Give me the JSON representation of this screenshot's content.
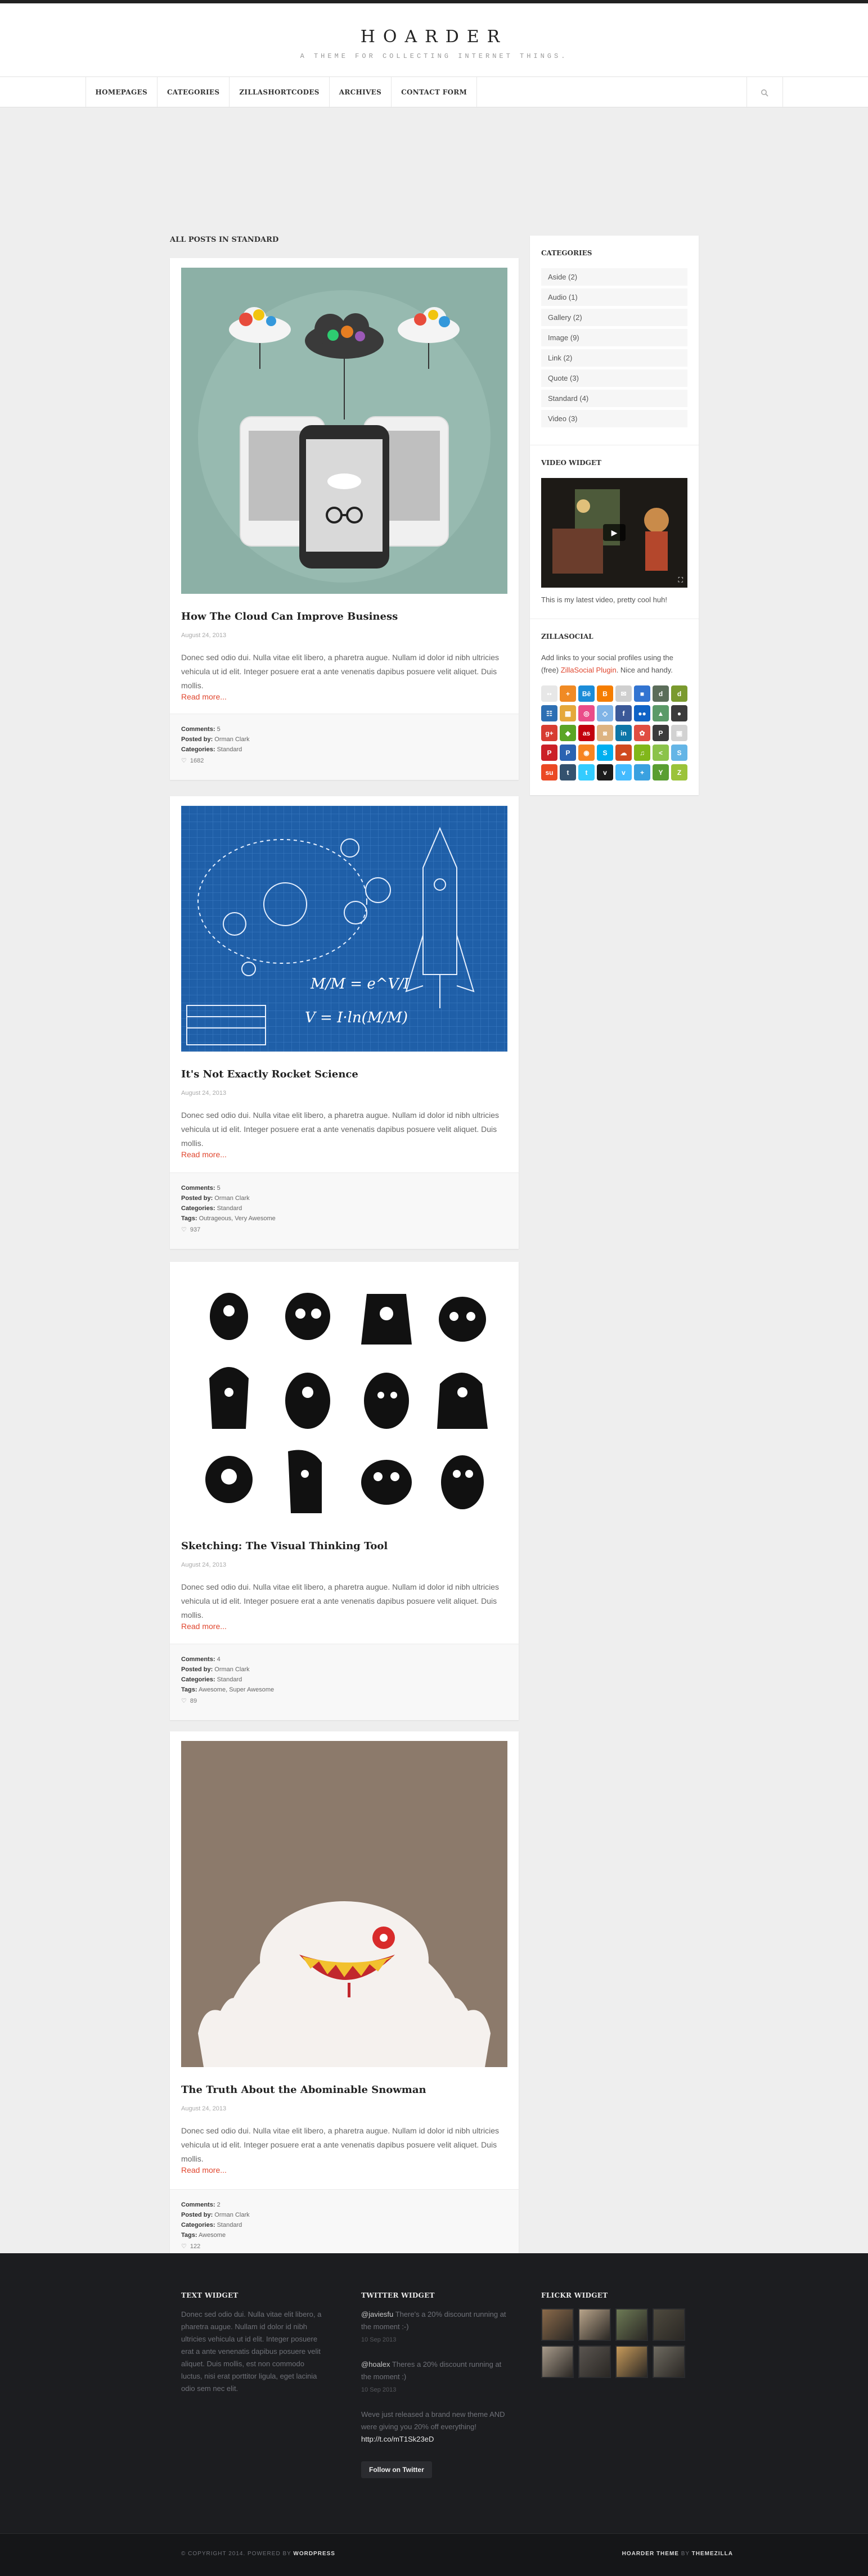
{
  "site": {
    "title": "HOARDER",
    "tagline": "A THEME FOR COLLECTING INTERNET THINGS."
  },
  "nav": {
    "items": [
      "HOMEPAGES",
      "CATEGORIES",
      "ZILLASHORTCODES",
      "ARCHIVES",
      "CONTACT FORM"
    ],
    "search_icon": "search-icon"
  },
  "archive_title": "ALL POSTS IN STANDARD",
  "posts": [
    {
      "title": "How The Cloud Can Improve Business",
      "date": "August 24, 2013",
      "excerpt": "Donec sed odio dui. Nulla vitae elit libero, a pharetra augue. Nullam id dolor id nibh ultricies vehicula ut id elit. Integer posuere erat a ante venenatis dapibus posuere velit aliquet. Duis mollis.",
      "read_more": "Read more...",
      "comments_label": "Comments:",
      "comments": "5",
      "posted_label": "Posted by:",
      "author": "Orman Clark",
      "categories_label": "Categories:",
      "categories": "Standard",
      "tags_label": "",
      "tags": "",
      "likes": "1682"
    },
    {
      "title": "It's Not Exactly Rocket Science",
      "date": "August 24, 2013",
      "excerpt": "Donec sed odio dui. Nulla vitae elit libero, a pharetra augue. Nullam id dolor id nibh ultricies vehicula ut id elit. Integer posuere erat a ante venenatis dapibus posuere velit aliquet. Duis mollis.",
      "read_more": "Read more...",
      "comments_label": "Comments:",
      "comments": "5",
      "posted_label": "Posted by:",
      "author": "Orman Clark",
      "categories_label": "Categories:",
      "categories": "Standard",
      "tags_label": "Tags:",
      "tags": "Outrageous, Very Awesome",
      "likes": "937"
    },
    {
      "title": "Sketching: The Visual Thinking Tool",
      "date": "August 24, 2013",
      "excerpt": "Donec sed odio dui. Nulla vitae elit libero, a pharetra augue. Nullam id dolor id nibh ultricies vehicula ut id elit. Integer posuere erat a ante venenatis dapibus posuere velit aliquet. Duis mollis.",
      "read_more": "Read more...",
      "comments_label": "Comments:",
      "comments": "4",
      "posted_label": "Posted by:",
      "author": "Orman Clark",
      "categories_label": "Categories:",
      "categories": "Standard",
      "tags_label": "Tags:",
      "tags": "Awesome, Super Awesome",
      "likes": "89"
    },
    {
      "title": "The Truth About the Abominable Snowman",
      "date": "August 24, 2013",
      "excerpt": "Donec sed odio dui. Nulla vitae elit libero, a pharetra augue. Nullam id dolor id nibh ultricies vehicula ut id elit. Integer posuere erat a ante venenatis dapibus posuere velit aliquet. Duis mollis.",
      "read_more": "Read more...",
      "comments_label": "Comments:",
      "comments": "2",
      "posted_label": "Posted by:",
      "author": "Orman Clark",
      "categories_label": "Categories:",
      "categories": "Standard",
      "tags_label": "Tags:",
      "tags": "Awesome",
      "likes": "122"
    }
  ],
  "sidebar": {
    "categories_title": "CATEGORIES",
    "categories": [
      "Aside (2)",
      "Audio (1)",
      "Gallery (2)",
      "Image (9)",
      "Link (2)",
      "Quote (3)",
      "Standard (4)",
      "Video (3)"
    ],
    "video_title": "VIDEO WIDGET",
    "video_caption": "This is my latest video, pretty cool huh!",
    "social_title": "ZILLASOCIAL",
    "social_text_1": "Add links to your social profiles using the (free)",
    "social_link": "ZillaSocial Plugin",
    "social_text_2": ". Nice and handy.",
    "social_icons": [
      {
        "name": "flickr-icon",
        "color": "#e7e7e7",
        "glyph": "••"
      },
      {
        "name": "add-icon",
        "color": "#f08a24",
        "glyph": "+"
      },
      {
        "name": "behance-icon",
        "color": "#1b8cd8",
        "glyph": "Bē"
      },
      {
        "name": "blogger-icon",
        "color": "#f57d00",
        "glyph": "B"
      },
      {
        "name": "email-icon",
        "color": "#cfcfcf",
        "glyph": "✉"
      },
      {
        "name": "delicious-icon",
        "color": "#3274d1",
        "glyph": "■"
      },
      {
        "name": "deviantart-icon",
        "color": "#5b6d5a",
        "glyph": "d"
      },
      {
        "name": "digg-icon",
        "color": "#7a9a2e",
        "glyph": "d"
      },
      {
        "name": "dribbble-like-icon",
        "color": "#2d6fb3",
        "glyph": "☷"
      },
      {
        "name": "forrst-icon",
        "color": "#e5a83b",
        "glyph": "▦"
      },
      {
        "name": "dribbble-icon",
        "color": "#ea4c89",
        "glyph": "◎"
      },
      {
        "name": "dropbox-icon",
        "color": "#7fb3e6",
        "glyph": "◇"
      },
      {
        "name": "facebook-icon",
        "color": "#3b5998",
        "glyph": "f"
      },
      {
        "name": "flickr-dots-icon",
        "color": "#0f63c6",
        "glyph": "●●"
      },
      {
        "name": "forrst-tree-icon",
        "color": "#5b9a68",
        "glyph": "▲"
      },
      {
        "name": "github-icon",
        "color": "#3b3b3b",
        "glyph": "●"
      },
      {
        "name": "google-plus-icon",
        "color": "#d73d32",
        "glyph": "g+"
      },
      {
        "name": "evernote-icon",
        "color": "#5ba525",
        "glyph": "◆"
      },
      {
        "name": "lastfm-icon",
        "color": "#c3000d",
        "glyph": "as"
      },
      {
        "name": "instagram-icon",
        "color": "#ddb381",
        "glyph": "◙"
      },
      {
        "name": "linkedin-icon",
        "color": "#0e76a8",
        "glyph": "in"
      },
      {
        "name": "picasa-icon",
        "color": "#e04e42",
        "glyph": "✿"
      },
      {
        "name": "path-icon",
        "color": "#3b3b3b",
        "glyph": "P"
      },
      {
        "name": "picasa-alt-icon",
        "color": "#d2d2d2",
        "glyph": "▣"
      },
      {
        "name": "pinterest-icon",
        "color": "#cb2027",
        "glyph": "P"
      },
      {
        "name": "paypal-icon",
        "color": "#2a63b2",
        "glyph": "P"
      },
      {
        "name": "rss-icon",
        "color": "#f78422",
        "glyph": "◉"
      },
      {
        "name": "skype-icon",
        "color": "#00aff0",
        "glyph": "S"
      },
      {
        "name": "rdio-icon",
        "color": "#d04a1f",
        "glyph": "☁"
      },
      {
        "name": "spotify-icon",
        "color": "#81b71a",
        "glyph": "♫"
      },
      {
        "name": "share-icon",
        "color": "#8bc34a",
        "glyph": "<"
      },
      {
        "name": "skype-alt-icon",
        "color": "#64b5e6",
        "glyph": "S"
      },
      {
        "name": "stumbleupon-icon",
        "color": "#eb4924",
        "glyph": "su"
      },
      {
        "name": "tumblr-icon",
        "color": "#34526f",
        "glyph": "t"
      },
      {
        "name": "twitter-icon",
        "color": "#33ccff",
        "glyph": "t"
      },
      {
        "name": "vimeo-icon",
        "color": "#1b1b1b",
        "glyph": "v"
      },
      {
        "name": "vimeo-blue-icon",
        "color": "#44bbff",
        "glyph": "v"
      },
      {
        "name": "plus-icon",
        "color": "#3aa1e0",
        "glyph": "+"
      },
      {
        "name": "yahoo-icon",
        "color": "#5a9e31",
        "glyph": "Y"
      },
      {
        "name": "zerply-icon",
        "color": "#9bc33a",
        "glyph": "Z"
      }
    ]
  },
  "footer": {
    "text_widget_title": "TEXT WIDGET",
    "text_widget_body": "Donec sed odio dui. Nulla vitae elit libero, a pharetra augue. Nullam id dolor id nibh ultricies vehicula ut id elit. Integer posuere erat a ante venenatis dapibus posuere velit aliquet. Duis mollis, est non commodo luctus, nisi erat porttitor ligula, eget lacinia odio sem nec elit.",
    "twitter_title": "TWITTER WIDGET",
    "tweets": [
      {
        "handle": "@javiesfu",
        "text": " There's a 20% discount running at the moment :-)",
        "time": "10 Sep 2013"
      },
      {
        "handle": "@hoalex",
        "text": " Theres a 20% discount running at the moment :)",
        "time": "10 Sep 2013"
      },
      {
        "handle": "",
        "text": "Weve just released a brand new theme AND were giving you 20% off everything! ",
        "link": "http://t.co/mT1Sk23eD",
        "time": ""
      }
    ],
    "follow_button": "Follow on Twitter",
    "flickr_title": "FLICKR WIDGET",
    "flickr_colors": [
      "#8a6a4a",
      "#b8a48a",
      "#6d7a55",
      "#4e4a3e",
      "#a79a8a",
      "#5a5550",
      "#c79a5a",
      "#6e6a60"
    ],
    "copyright_prefix": "© COPYRIGHT 2014. POWERED BY ",
    "copyright_brand": "WORDPRESS",
    "credit_theme": "HOARDER THEME",
    "credit_by": " BY ",
    "credit_author": "THEMEZILLA"
  }
}
